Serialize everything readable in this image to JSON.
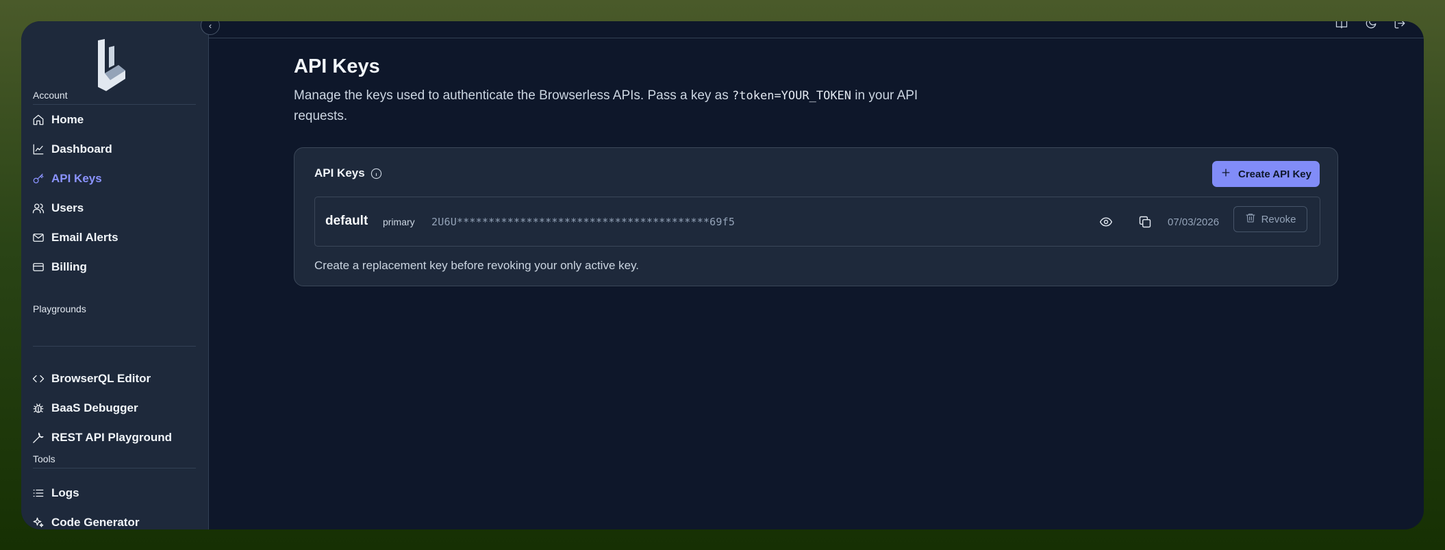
{
  "sidebar": {
    "sections": [
      {
        "label": "Account"
      },
      {
        "label": "Playgrounds"
      },
      {
        "label": "Tools"
      }
    ],
    "items": [
      {
        "label": "Home",
        "icon": "home-icon"
      },
      {
        "label": "Dashboard",
        "icon": "chart-line-icon"
      },
      {
        "label": "API Keys",
        "icon": "key-icon",
        "active": true
      },
      {
        "label": "Users",
        "icon": "users-icon"
      },
      {
        "label": "Email Alerts",
        "icon": "mail-icon"
      },
      {
        "label": "Billing",
        "icon": "credit-card-icon"
      },
      {
        "label": "BrowserQL Editor",
        "icon": "code-icon"
      },
      {
        "label": "BaaS Debugger",
        "icon": "bug-icon"
      },
      {
        "label": "REST API Playground",
        "icon": "wrench-icon"
      },
      {
        "label": "Logs",
        "icon": "list-icon"
      },
      {
        "label": "Code Generator",
        "icon": "sparkles-icon"
      }
    ]
  },
  "header": {
    "icons": [
      "book-icon",
      "moon-icon",
      "logout-icon"
    ]
  },
  "page": {
    "title": "API Keys",
    "desc_before": "Manage the keys used to authenticate the Browserless APIs. Pass a key as ",
    "desc_code": "?token=YOUR_TOKEN",
    "desc_after": " in your API requests."
  },
  "card": {
    "title": "API Keys",
    "create_label": "Create API Key",
    "keys": [
      {
        "name": "default",
        "tag": "primary",
        "value": "2U6U****************************************69f5",
        "date": "07/03/2026",
        "revoke_label": "Revoke"
      }
    ],
    "note": "Create a replacement key before revoking your only active key."
  },
  "colors": {
    "accent": "#818cf8",
    "active_nav": "#8b93ff",
    "bg": "#0e172a",
    "sidebar_bg": "#1e293b"
  }
}
